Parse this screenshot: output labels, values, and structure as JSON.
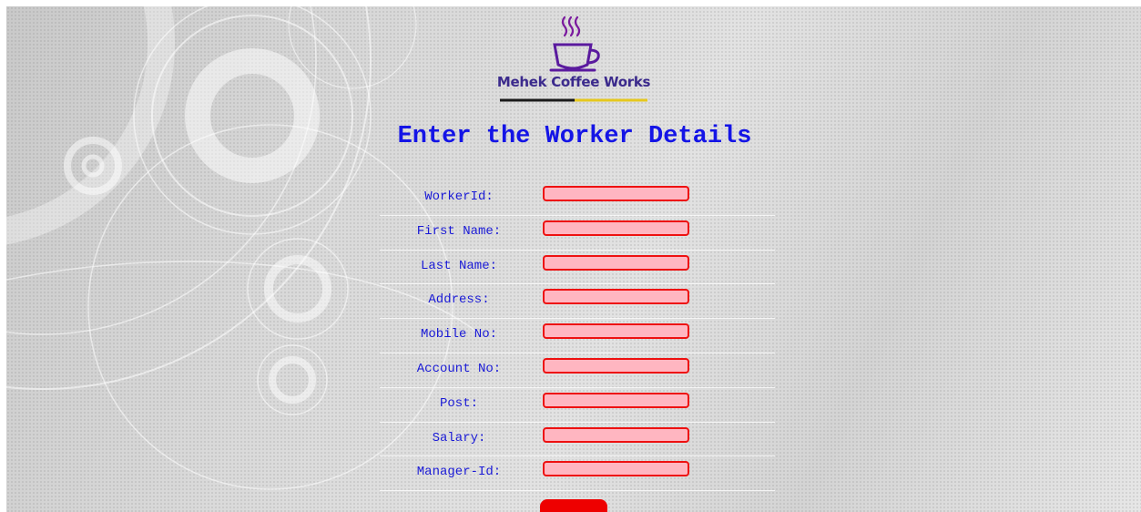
{
  "brand": {
    "name": "Mehek Coffee Works",
    "logo_icon": "coffee-cup-icon"
  },
  "page": {
    "title": "Enter the Worker Details"
  },
  "form": {
    "fields": [
      {
        "label": "WorkerId:",
        "value": ""
      },
      {
        "label": "First Name:",
        "value": ""
      },
      {
        "label": "Last Name:",
        "value": ""
      },
      {
        "label": "Address:",
        "value": ""
      },
      {
        "label": "Mobile No:",
        "value": ""
      },
      {
        "label": "Account No:",
        "value": ""
      },
      {
        "label": "Post:",
        "value": ""
      },
      {
        "label": "Salary:",
        "value": ""
      },
      {
        "label": "Manager-Id:",
        "value": ""
      }
    ],
    "submit_label": ""
  },
  "colors": {
    "title": "#1414e6",
    "label": "#1a1ad6",
    "field_bg": "#ffb6c1",
    "field_border": "#ee1111",
    "button": "#ee0000",
    "brand_text": "#3b2a8c"
  }
}
